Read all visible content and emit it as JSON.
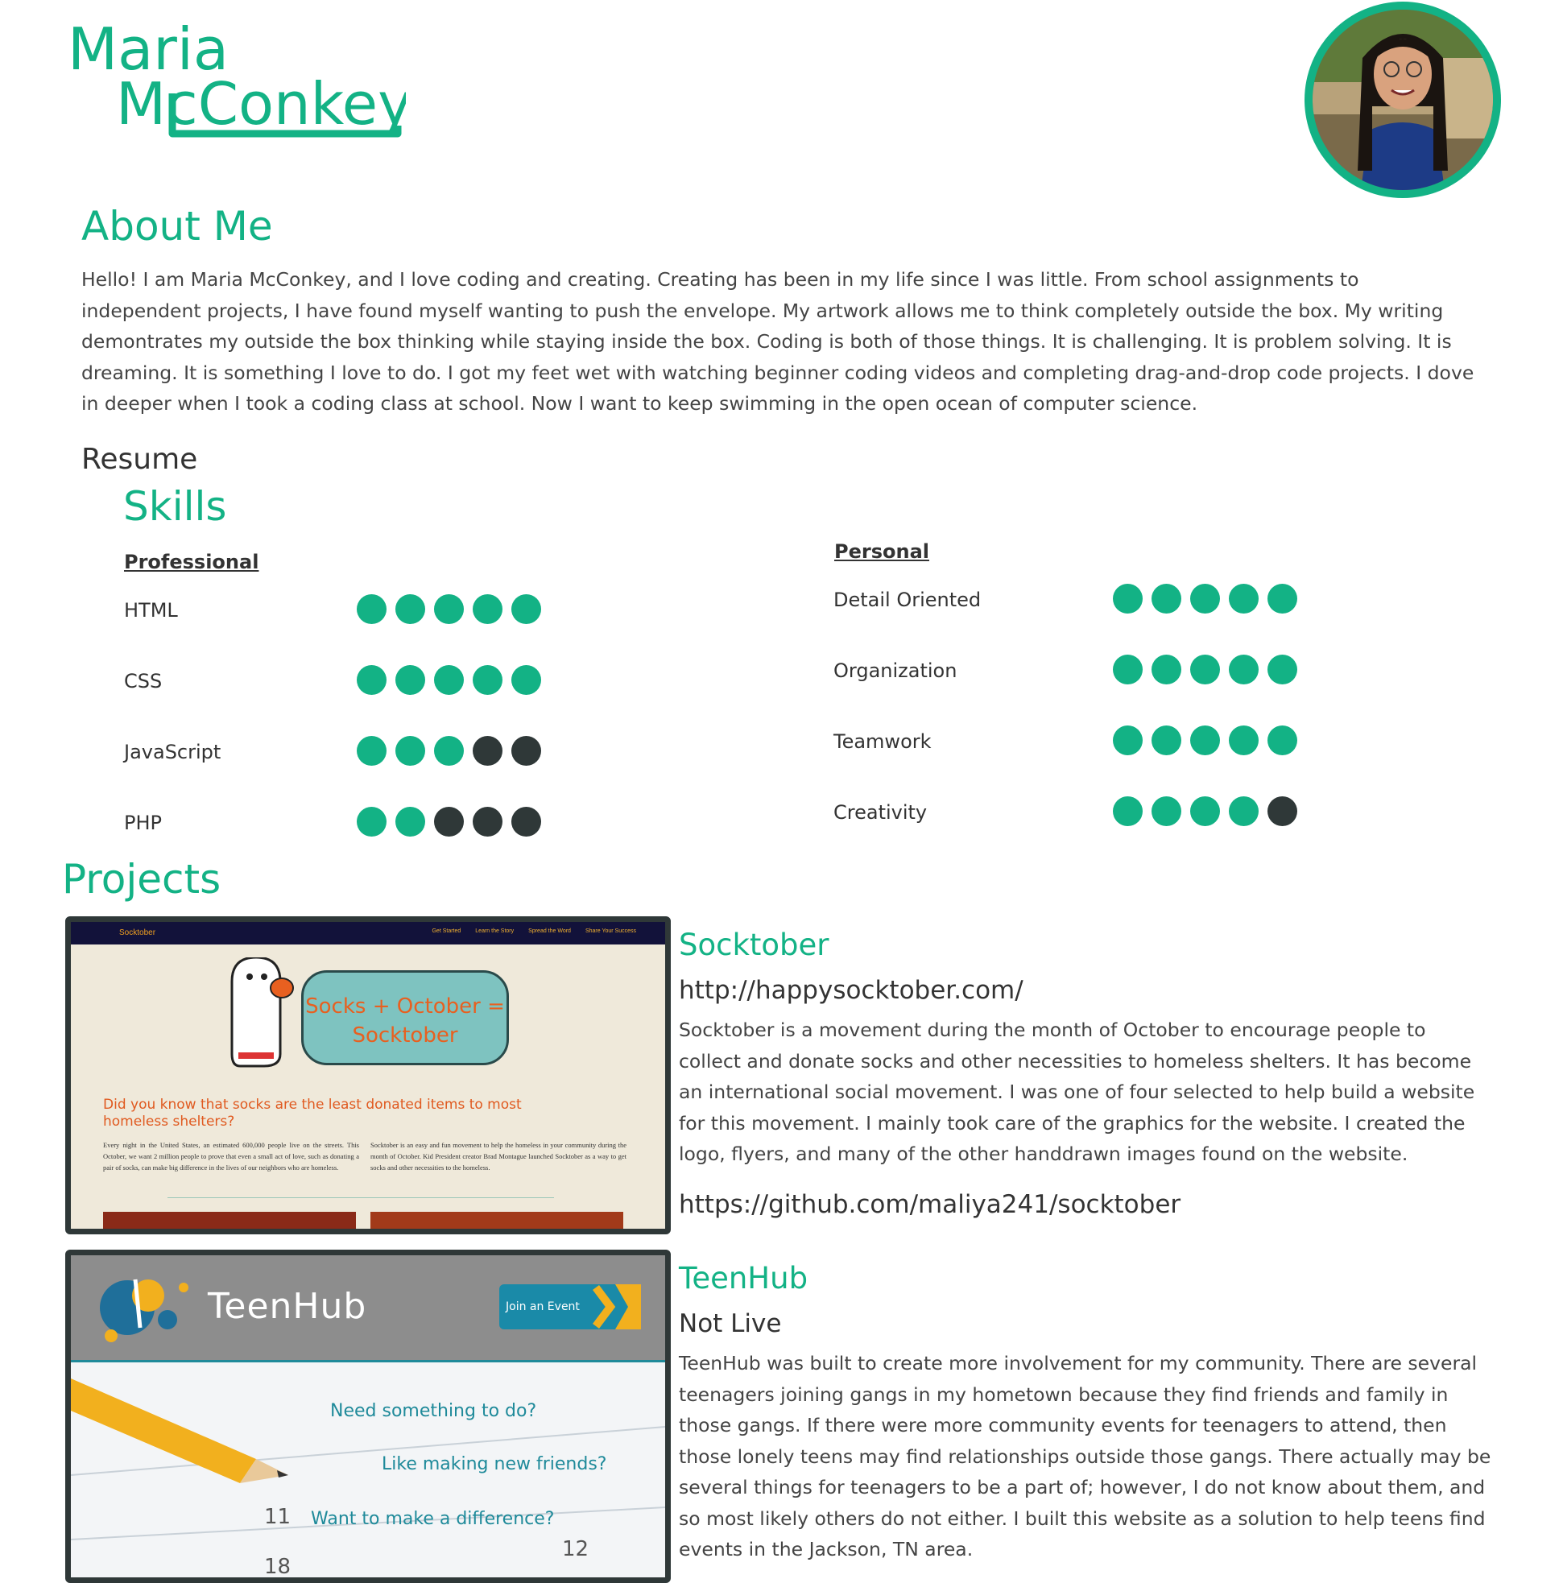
{
  "header": {
    "name_line1": "Maria",
    "name_line2": "McConkey"
  },
  "about": {
    "heading": "About Me",
    "text": "Hello! I am Maria McConkey, and I love coding and creating. Creating has been in my life since I was little. From school assignments to independent projects, I have found myself wanting to push the envelope. My artwork allows me to think completely outside the box. My writing demontrates my outside the box thinking while staying inside the box. Coding is both of those things. It is challenging. It is problem solving. It is dreaming. It is something I love to do. I got my feet wet with watching beginner coding videos and completing drag-and-drop code projects. I dove in deeper when I took a coding class at school. Now I want to keep swimming in the open ocean of computer science."
  },
  "resume": {
    "label": "Resume",
    "skills_heading": "Skills",
    "professional": {
      "title": "Professional",
      "items": [
        {
          "name": "HTML",
          "rating": 5
        },
        {
          "name": "CSS",
          "rating": 5
        },
        {
          "name": "JavaScript",
          "rating": 3
        },
        {
          "name": "PHP",
          "rating": 2
        }
      ]
    },
    "personal": {
      "title": "Personal",
      "items": [
        {
          "name": "Detail Oriented",
          "rating": 5
        },
        {
          "name": "Organization",
          "rating": 5
        },
        {
          "name": "Teamwork",
          "rating": 5
        },
        {
          "name": "Creativity",
          "rating": 4
        }
      ]
    },
    "max_rating": 5
  },
  "projects": {
    "heading": "Projects",
    "items": [
      {
        "title": "Socktober",
        "link": "http://happysocktober.com/",
        "description": "Socktober is a movement during the month of October to encourage people to collect and donate socks and other necessities to homeless shelters. It has become an international social movement. I was one of four selected to help build a website for this movement. I mainly took care of the graphics for the website. I created the logo, flyers, and many of the other handdrawn images found on the website.",
        "repo": "https://github.com/maliya241/socktober",
        "screenshot": {
          "brand": "Socktober",
          "nav": [
            "Get Started",
            "Learn the Story",
            "Spread the Word",
            "Share Your Success"
          ],
          "bubble_line1": "Socks + October =",
          "bubble_line2": "Socktober",
          "question": "Did you know that socks are the least donated items to most homeless shelters?",
          "col1": "Every night in the United States, an estimated 600,000 people live on the streets. This October, we want 2 million people to prove that even a small act of love, such as donating a pair of socks, can make big difference in the lives of our neighbors who are homeless.",
          "col2": "Socktober is an easy and fun movement to help the homeless in your community during the month of October. Kid President creator Brad Montague launched Socktober as a way to get socks and other necessities to the homeless."
        }
      },
      {
        "title": "TeenHub",
        "link": "Not Live",
        "description": "TeenHub was built to create more involvement for my community. There are several teenagers joining gangs in my hometown because they find friends and family in those gangs. If there were more community events for teenagers to attend, then those lonely teens may find relationships outside those gangs. There actually may be several things for teenagers to be a part of; however, I do not know about them, and so most likely others do not either. I built this website as a solution to help teens find events in the Jackson, TN area.",
        "screenshot": {
          "logo": "TeenHub",
          "button": "Join an Event",
          "line1": "Need something to do?",
          "line2": "Like making new friends?",
          "line3": "Want to make a difference?"
        }
      }
    ]
  },
  "colors": {
    "accent": "#13b285",
    "dot_off": "#2f3838",
    "text": "#444444"
  }
}
